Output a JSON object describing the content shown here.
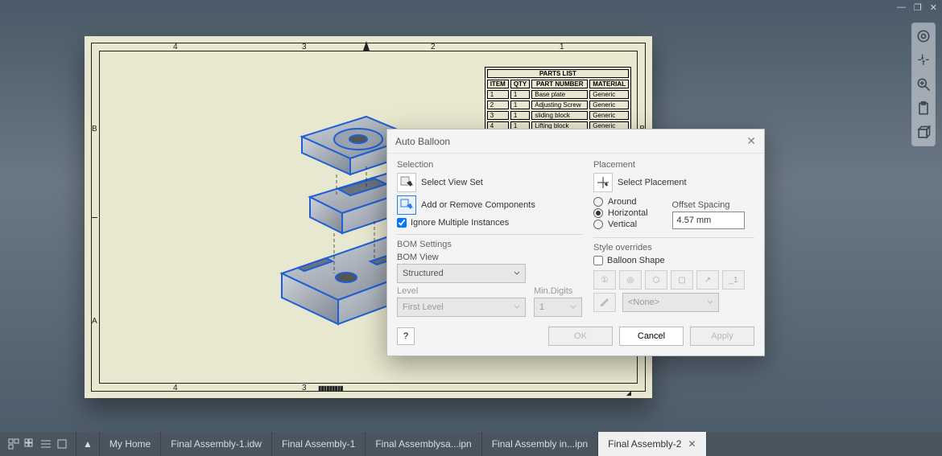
{
  "window_controls": {
    "minimize": "—",
    "maximize": "❐",
    "close": "✕"
  },
  "sheet": {
    "ruler_top": [
      "4",
      "3",
      "2",
      "1"
    ],
    "ruler_side": [
      "B",
      "A"
    ]
  },
  "parts_list": {
    "title": "PARTS LIST",
    "headers": [
      "ITEM",
      "QTY",
      "PART NUMBER",
      "MATERIAL"
    ],
    "rows": [
      [
        "1",
        "1",
        "Base plate",
        "Generic"
      ],
      [
        "2",
        "1",
        "Adjusting Screw",
        "Generic"
      ],
      [
        "3",
        "1",
        "sliding block",
        "Generic"
      ],
      [
        "4",
        "1",
        "Lifting block",
        "Generic"
      ]
    ]
  },
  "side_tools": [
    "home-icon",
    "pan-icon",
    "zoom-icon",
    "clipboard-icon",
    "viewcube-icon"
  ],
  "dialog": {
    "title": "Auto Balloon",
    "selection": {
      "label": "Selection",
      "select_view_set": "Select View Set",
      "add_remove": "Add or Remove Components",
      "ignore_multiple": "Ignore Multiple Instances",
      "ignore_checked": true
    },
    "bom": {
      "label": "BOM Settings",
      "view_label": "BOM View",
      "view_value": "Structured",
      "level_label": "Level",
      "level_value": "First Level",
      "min_digits_label": "Min.Digits",
      "min_digits_value": "1"
    },
    "placement": {
      "label": "Placement",
      "select_placement": "Select Placement",
      "around": "Around",
      "horizontal": "Horizontal",
      "vertical": "Vertical",
      "selected": "Horizontal",
      "offset_label": "Offset Spacing",
      "offset_value": "4.57 mm"
    },
    "style": {
      "label": "Style overrides",
      "balloon_shape": "Balloon Shape",
      "balloon_checked": false,
      "none_value": "<None>"
    },
    "buttons": {
      "help": "?",
      "ok": "OK",
      "cancel": "Cancel",
      "apply": "Apply"
    }
  },
  "tabs": {
    "items": [
      {
        "label": "My Home",
        "active": false
      },
      {
        "label": "Final Assembly-1.idw",
        "active": false
      },
      {
        "label": "Final Assembly-1",
        "active": false
      },
      {
        "label": "Final Assemblysa...ipn",
        "active": false
      },
      {
        "label": "Final Assembly in...ipn",
        "active": false
      },
      {
        "label": "Final Assembly-2",
        "active": true,
        "closeable": true
      }
    ]
  }
}
